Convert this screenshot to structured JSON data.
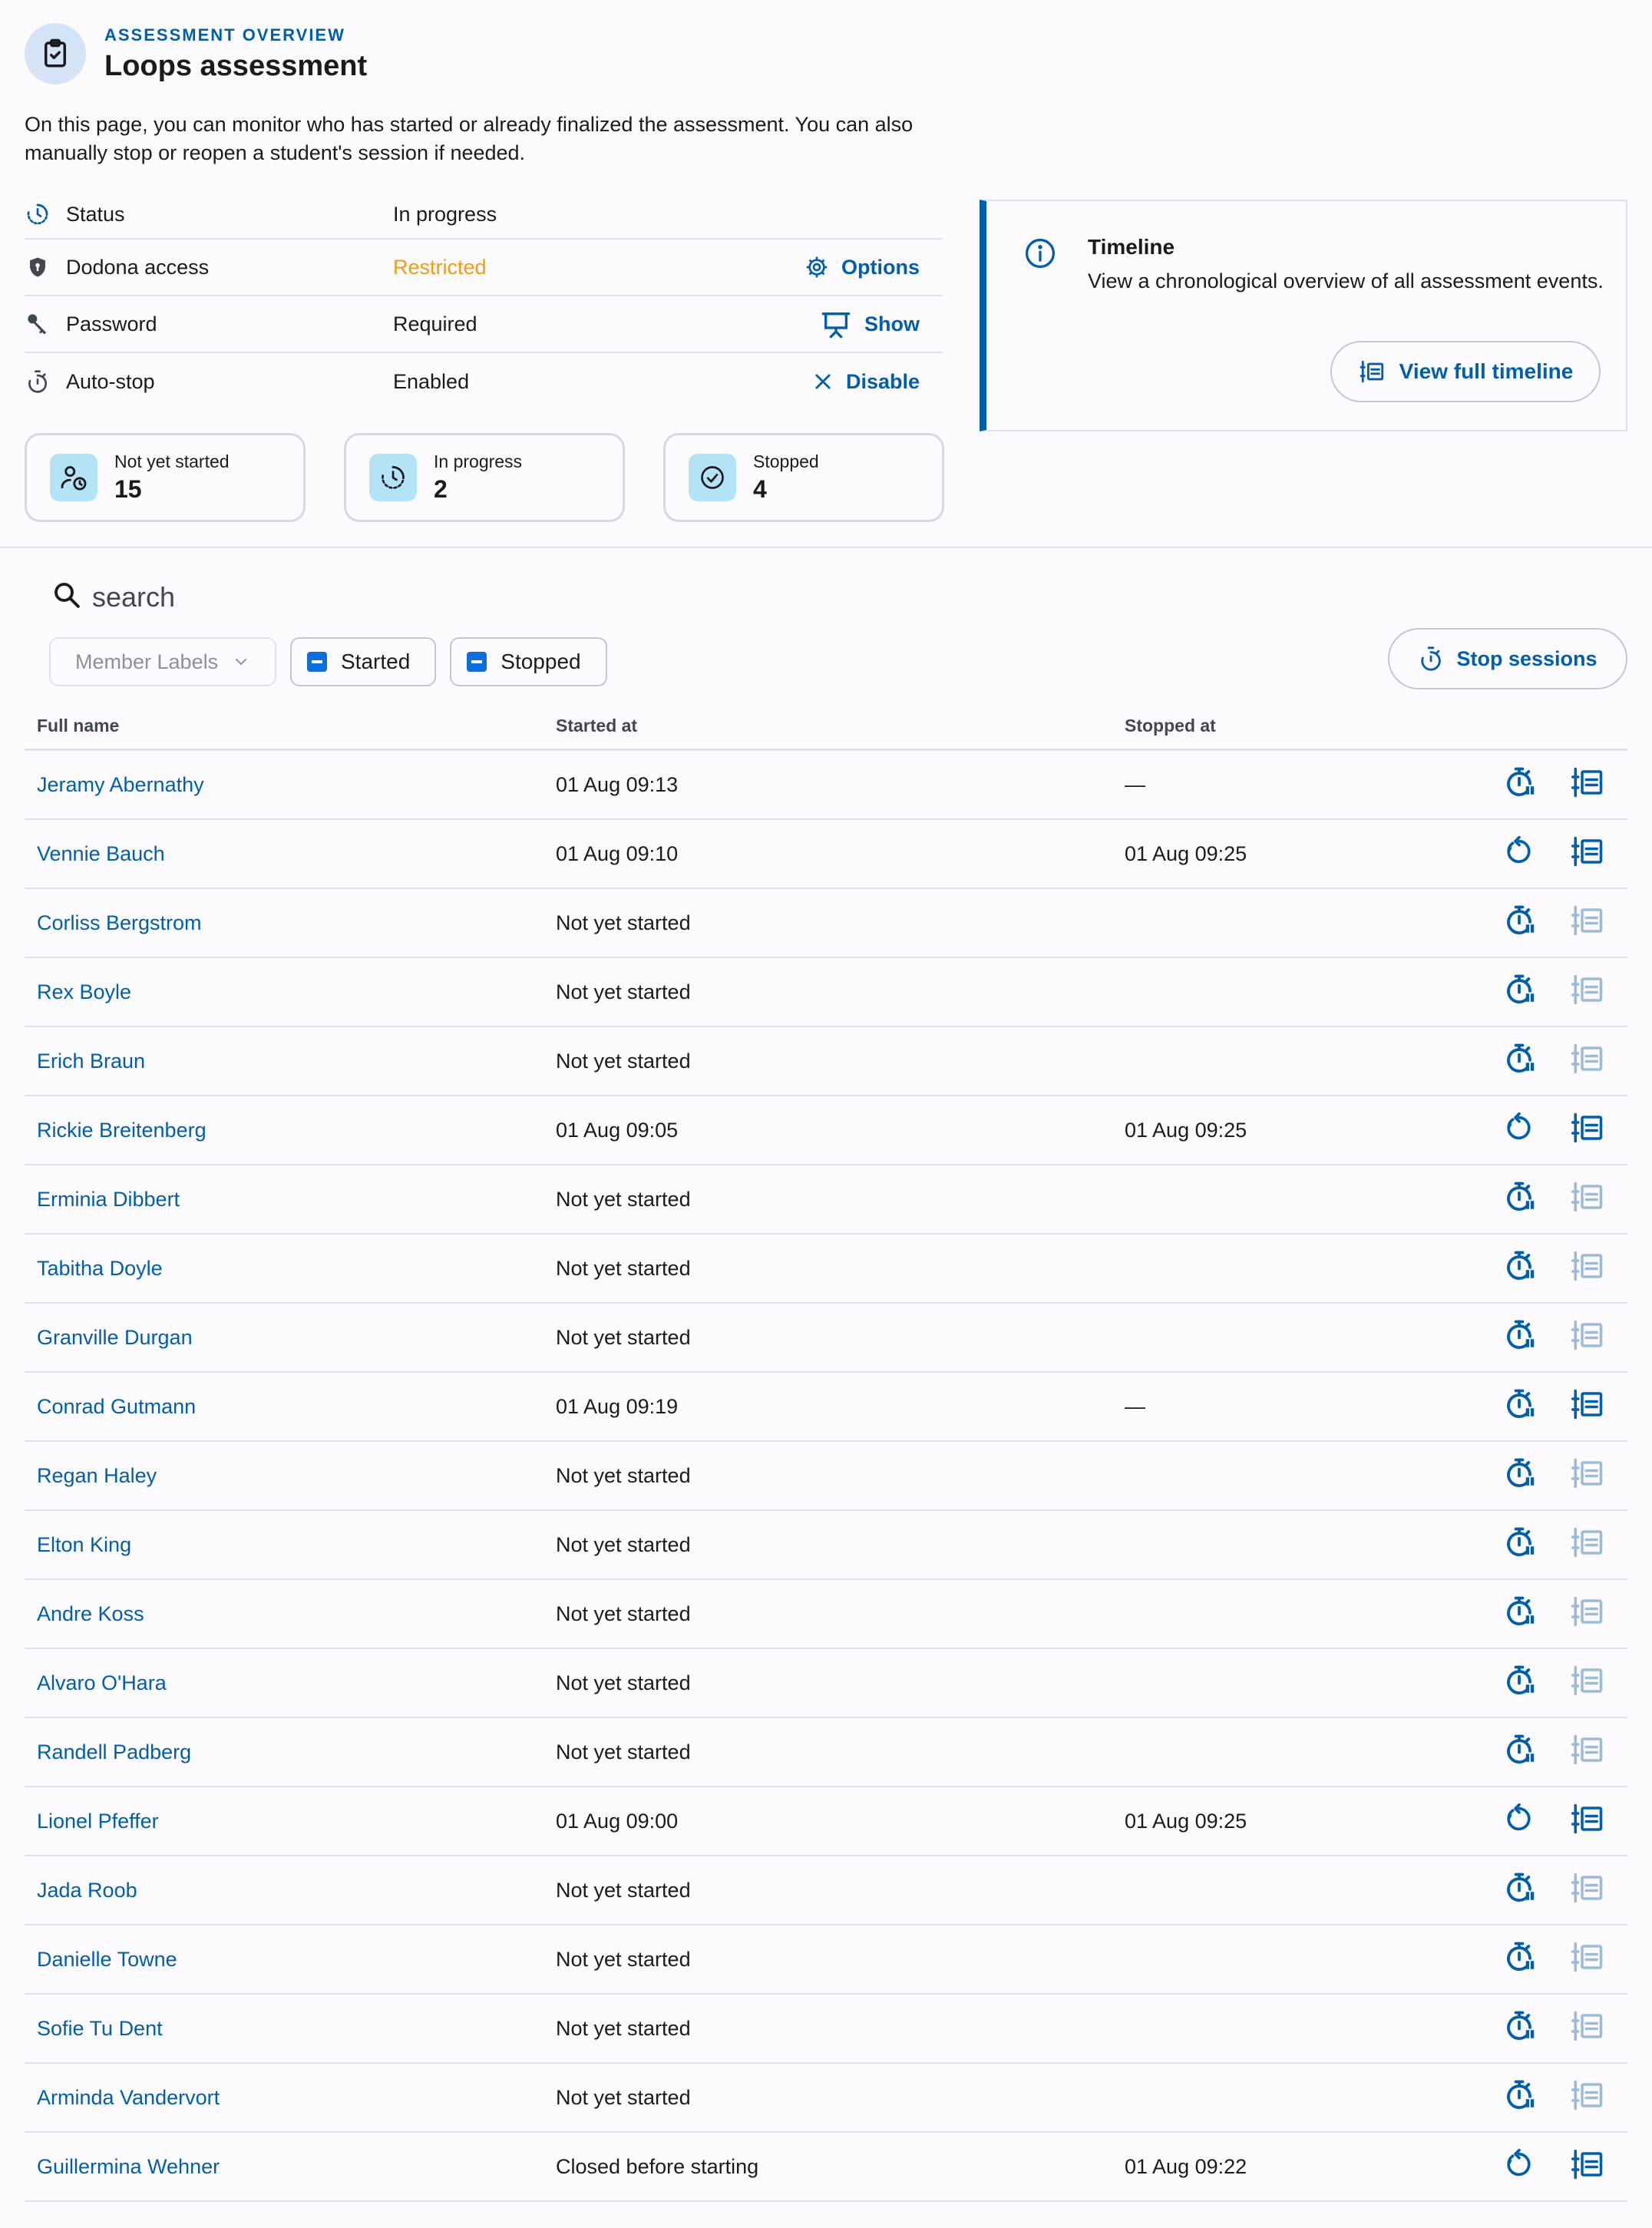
{
  "header": {
    "overline": "ASSESSMENT OVERVIEW",
    "title": "Loops assessment",
    "description": "On this page, you can monitor who has started or already finalized the assessment. You can also manually stop or reopen a student's session if needed."
  },
  "info": {
    "status": {
      "label": "Status",
      "value": "In progress"
    },
    "access": {
      "label": "Dodona access",
      "value": "Restricted",
      "action": "Options"
    },
    "password": {
      "label": "Password",
      "value": "Required",
      "action": "Show"
    },
    "autostop": {
      "label": "Auto-stop",
      "value": "Enabled",
      "action": "Disable"
    }
  },
  "stats": {
    "not_started": {
      "label": "Not yet started",
      "count": "15"
    },
    "in_progress": {
      "label": "In progress",
      "count": "2"
    },
    "stopped": {
      "label": "Stopped",
      "count": "4"
    }
  },
  "timeline": {
    "title": "Timeline",
    "text": "View a chronological overview of all assessment events.",
    "button": "View full timeline"
  },
  "search": {
    "placeholder": "search"
  },
  "filters": {
    "member_labels": "Member Labels",
    "started": "Started",
    "stopped": "Stopped"
  },
  "stop_sessions": "Stop sessions",
  "table": {
    "headers": {
      "name": "Full name",
      "started": "Started at",
      "stopped": "Stopped at"
    },
    "rows": [
      {
        "name": "Jeramy Abernathy",
        "started": "01 Aug 09:13",
        "stopped": "—",
        "action": "stop",
        "timeline": true
      },
      {
        "name": "Vennie Bauch",
        "started": "01 Aug 09:10",
        "stopped": "01 Aug 09:25",
        "action": "reopen",
        "timeline": true
      },
      {
        "name": "Corliss Bergstrom",
        "started": "Not yet started",
        "stopped": "",
        "action": "stop",
        "timeline": false
      },
      {
        "name": "Rex Boyle",
        "started": "Not yet started",
        "stopped": "",
        "action": "stop",
        "timeline": false
      },
      {
        "name": "Erich Braun",
        "started": "Not yet started",
        "stopped": "",
        "action": "stop",
        "timeline": false
      },
      {
        "name": "Rickie Breitenberg",
        "started": "01 Aug 09:05",
        "stopped": "01 Aug 09:25",
        "action": "reopen",
        "timeline": true
      },
      {
        "name": "Erminia Dibbert",
        "started": "Not yet started",
        "stopped": "",
        "action": "stop",
        "timeline": false
      },
      {
        "name": "Tabitha Doyle",
        "started": "Not yet started",
        "stopped": "",
        "action": "stop",
        "timeline": false
      },
      {
        "name": "Granville Durgan",
        "started": "Not yet started",
        "stopped": "",
        "action": "stop",
        "timeline": false
      },
      {
        "name": "Conrad Gutmann",
        "started": "01 Aug 09:19",
        "stopped": "—",
        "action": "stop",
        "timeline": true
      },
      {
        "name": "Regan Haley",
        "started": "Not yet started",
        "stopped": "",
        "action": "stop",
        "timeline": false
      },
      {
        "name": "Elton King",
        "started": "Not yet started",
        "stopped": "",
        "action": "stop",
        "timeline": false
      },
      {
        "name": "Andre Koss",
        "started": "Not yet started",
        "stopped": "",
        "action": "stop",
        "timeline": false
      },
      {
        "name": "Alvaro O'Hara",
        "started": "Not yet started",
        "stopped": "",
        "action": "stop",
        "timeline": false
      },
      {
        "name": "Randell Padberg",
        "started": "Not yet started",
        "stopped": "",
        "action": "stop",
        "timeline": false
      },
      {
        "name": "Lionel Pfeffer",
        "started": "01 Aug 09:00",
        "stopped": "01 Aug 09:25",
        "action": "reopen",
        "timeline": true
      },
      {
        "name": "Jada Roob",
        "started": "Not yet started",
        "stopped": "",
        "action": "stop",
        "timeline": false
      },
      {
        "name": "Danielle Towne",
        "started": "Not yet started",
        "stopped": "",
        "action": "stop",
        "timeline": false
      },
      {
        "name": "Sofie Tu Dent",
        "started": "Not yet started",
        "stopped": "",
        "action": "stop",
        "timeline": false
      },
      {
        "name": "Arminda Vandervort",
        "started": "Not yet started",
        "stopped": "",
        "action": "stop",
        "timeline": false
      },
      {
        "name": "Guillermina Wehner",
        "started": "Closed before starting",
        "stopped": "01 Aug 09:22",
        "action": "reopen",
        "timeline": true
      }
    ]
  },
  "icons": {
    "header": "assignment-check-icon",
    "status": "progress-clock-icon",
    "access": "shield-icon",
    "password": "key-icon",
    "autostop": "timer-icon",
    "options": "gear-icon",
    "show": "presentation-icon",
    "disable": "close-icon",
    "stop_action": "timer-stop-icon",
    "reopen_action": "reopen-icon",
    "timeline_action": "timeline-icon"
  },
  "colors": {
    "primary": "#005fa8",
    "warning": "#f39c12",
    "card_icon_bg": "#b3e3f5",
    "disabled_icon": "#9bbbd6"
  }
}
